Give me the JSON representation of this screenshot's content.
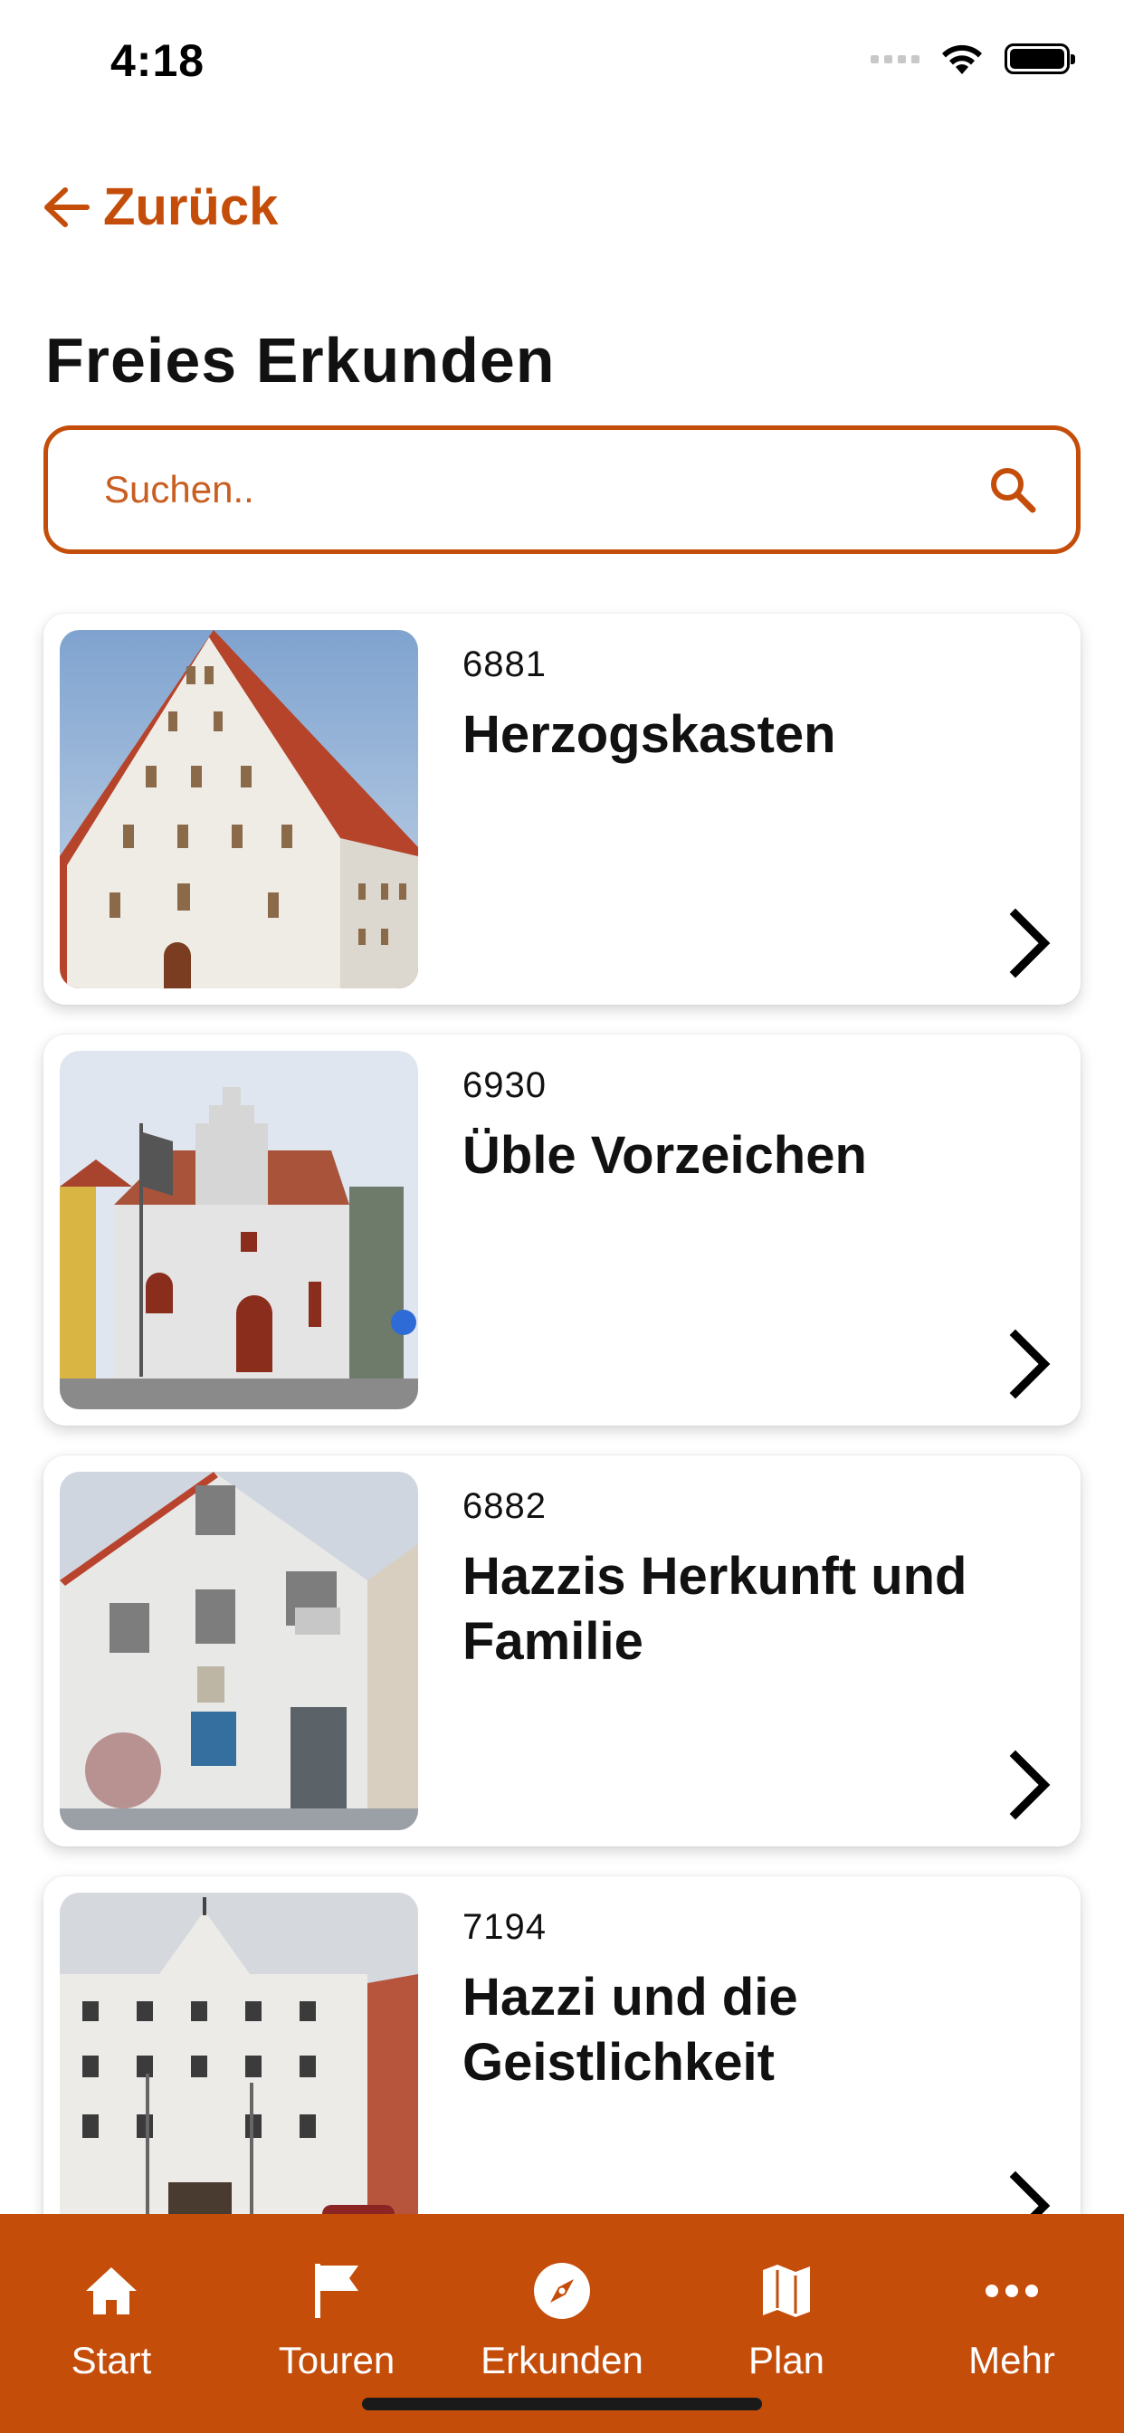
{
  "status_bar": {
    "time": "4:18"
  },
  "nav": {
    "back_label": "Zurück"
  },
  "page": {
    "title": "Freies Erkunden"
  },
  "search": {
    "placeholder": "Suchen.."
  },
  "colors": {
    "accent": "#c44d0a",
    "text": "#111111",
    "background": "#ffffff"
  },
  "items": [
    {
      "number": "6881",
      "title": "Herzogskasten"
    },
    {
      "number": "6930",
      "title": "Üble Vorzeichen"
    },
    {
      "number": "6882",
      "title": "Hazzis Herkunft und Familie"
    },
    {
      "number": "7194",
      "title": "Hazzi und die Geistlichkeit"
    }
  ],
  "tabs": [
    {
      "label": "Start",
      "icon": "home-icon"
    },
    {
      "label": "Touren",
      "icon": "flag-icon"
    },
    {
      "label": "Erkunden",
      "icon": "compass-icon",
      "active": true
    },
    {
      "label": "Plan",
      "icon": "map-icon"
    },
    {
      "label": "Mehr",
      "icon": "more-icon"
    }
  ]
}
